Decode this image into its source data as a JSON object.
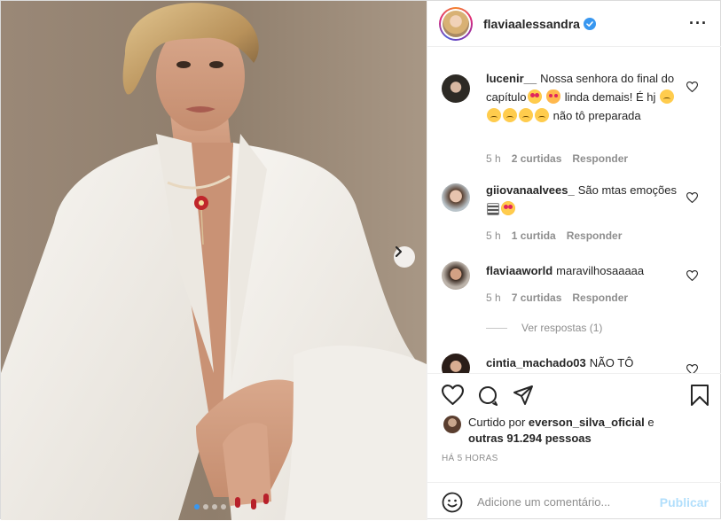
{
  "post": {
    "username": "flaviaalessandra",
    "verified": true,
    "more_icon": "more-dots-icon"
  },
  "media": {
    "alt": "photo",
    "next_icon": "chevron-right-icon",
    "carousel_count": 4,
    "carousel_active_index": 0
  },
  "comments": [
    {
      "username": "lucenir__",
      "text_parts": [
        "Nossa senhora do final do capítulo",
        " linda demais! É hj ",
        " não tô preparada"
      ],
      "time": "5 h",
      "likes": "2 curtidas",
      "reply": "Responder"
    },
    {
      "username": "giiovanaalvees_",
      "text_parts": [
        "São mtas emoções "
      ],
      "time": "5 h",
      "likes": "1 curtida",
      "reply": "Responder"
    },
    {
      "username": "flaviaaworld",
      "text_parts": [
        "maravilhosaaaaa"
      ],
      "time": "5 h",
      "likes": "7 curtidas",
      "reply": "Responder",
      "view_replies": "Ver respostas (1)"
    },
    {
      "username": "cintia_machado03",
      "text_parts": [
        "NÃO TÔ"
      ]
    }
  ],
  "likes": {
    "prefix": "Curtido por ",
    "user": "everson_silva_oficial",
    "middle": " e",
    "others": "outras 91.294 pessoas"
  },
  "time_ago": "HÁ 5 HORAS",
  "add_comment": {
    "placeholder": "Adicione um comentário...",
    "publish": "Publicar"
  },
  "colors": {
    "accent": "#0095f6",
    "publish_disabled": "#b2dffc",
    "muted": "#8e8e8e"
  }
}
